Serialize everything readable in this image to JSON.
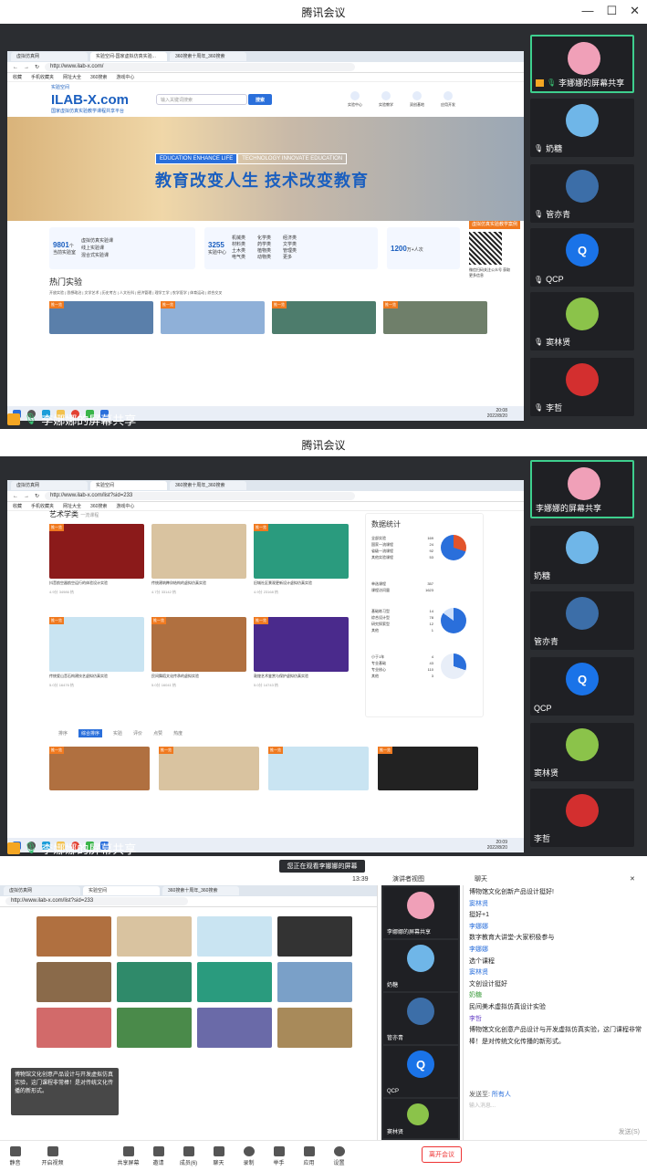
{
  "app_title": "腾讯会议",
  "window_controls": [
    "—",
    "☐",
    "✕"
  ],
  "share_label": "李娜娜的屏幕共享",
  "participants": [
    {
      "name": "李娜娜的屏幕共享",
      "color": "#f0a0b8"
    },
    {
      "name": "奶糖",
      "color": "#6fb6e8"
    },
    {
      "name": "管亦青",
      "color": "#3c6ea8"
    },
    {
      "name": "QCP",
      "color": "#1a73e8"
    },
    {
      "name": "窦林贤",
      "color": "#8bc34a"
    },
    {
      "name": "李哲",
      "color": "#d32f2f"
    }
  ],
  "browser": {
    "tabs": [
      "虚拟仿真网",
      "实验空间",
      "360搜索十周年_360搜索"
    ],
    "tabs_p1": [
      "虚拟仿真网",
      "实验空间-国家虚拟仿真实验...",
      "360搜索十周年_360搜索"
    ],
    "url1": "http://www.ilab-x.com/",
    "url2": "http://www.ilab-x.com/list?sid=233",
    "bookmarks": [
      "收藏",
      "手机收藏夹",
      "网址大全",
      "360搜索",
      "游戏中心"
    ]
  },
  "site": {
    "logo": "ILAB-X.com",
    "logo_top": "实验空间",
    "logo_sub": "国家虚拟仿真实验教学课程共享平台",
    "search_placeholder": "输入关键词搜索",
    "search_btn": "搜索",
    "nav": [
      "实验中心",
      "实验教学",
      "双创基地",
      "应用开发"
    ],
    "banner_tag1": "EDUCATION ENHANCE LIFE",
    "banner_tag2": "TECHNOLOGY INNOVATE EDUCATION",
    "banner_text": "教育改变人生  技术改变教育",
    "stat1_num": "9801",
    "stat1_unit": "个",
    "stat1_label": "当前实验室",
    "stat1_items": [
      "虚拟仿真实验课",
      "线上实验课",
      "混合式实验课"
    ],
    "stat2_num": "3255",
    "stat2_label": "实验中心",
    "stat2_items": [
      "机械类",
      "材料类",
      "土木类",
      "电气类",
      "化学类",
      "药学类",
      "植物类",
      "动物类",
      "经济类",
      "文学类",
      "管理类",
      "更多"
    ],
    "stat3_num": "1200",
    "stat3_label": "万+人次",
    "orange_btn": "虚拟仿真实验教学案例",
    "qr_caption": "微信扫码关注公众号 获取更多信息",
    "hot_title": "热门实验",
    "hot_line": "开放实验 | 思想政治 | 文学艺术 | 历史考古 | 人文社科 | 经济管理 | 理学工学 | 农学医学 | 体育运动 | 综合交叉",
    "card_tag": "推一览"
  },
  "taskbar": {
    "time": "20:08",
    "date": "2022/8/20",
    "time2": "20:09"
  },
  "list_page": {
    "section": "艺术学类",
    "section2": "一流课程",
    "cards": [
      {
        "title": "抖音航空器航空运行的体验设计实验",
        "score": "4.9分",
        "meta": "34986 热",
        "color": "#8b1a1a"
      },
      {
        "title": "传统建筑榫卯结构的虚拟仿真实验",
        "score": "4.7分",
        "meta": "33142 热",
        "color": "#d9c3a0"
      },
      {
        "title": "旧城社区景观更新设计虚拟仿真实验",
        "score": "4.9分",
        "meta": "23168 热",
        "color": "#2a9b7e"
      },
      {
        "title": "传统瓷山音石构建技艺虚拟仿真实验",
        "score": "5.0分",
        "meta": "16476 热",
        "color": "#c9e4f2"
      },
      {
        "title": "民间舞蹈文化传承的虚拟实验",
        "score": "5.0分",
        "meta": "16041 热",
        "color": "#b07040"
      },
      {
        "title": "敦煌艺术鉴赏与保护虚拟仿真实验",
        "score": "5.0分",
        "meta": "14743 热",
        "color": "#4a2a8c"
      }
    ],
    "stats_title": "数据统计",
    "stats_groups": [
      [
        [
          "全部实验",
          "169"
        ],
        [
          "国家一流课程",
          "24"
        ],
        [
          "省级一流课程",
          "92"
        ],
        [
          "其他实验课程",
          "53"
        ]
      ],
      [
        [
          "单选课程",
          "357"
        ],
        [
          "课程访问量",
          "1623"
        ]
      ],
      [
        [
          "基础练习型",
          "14"
        ],
        [
          "综合设计型",
          "78"
        ],
        [
          "研究探索型",
          "12"
        ],
        [
          "其他",
          "1"
        ]
      ],
      [
        [
          "小于1年",
          "4"
        ],
        [
          "专业基础",
          "43"
        ],
        [
          "专业核心",
          "110"
        ],
        [
          "其他",
          "3"
        ]
      ]
    ],
    "sort_label": "排序",
    "sort_active": "综合排序",
    "sort_items": [
      "实验",
      "评价",
      "点赞",
      "热度"
    ]
  },
  "panel3": {
    "banner": "您正在观看李娜娜的屏幕",
    "time": "13:39",
    "view_mode": "演讲者视图",
    "chat_title": "聊天",
    "messages": [
      {
        "user": "",
        "text": "博物馆文化创新产品设计挺好!"
      },
      {
        "user": "窦林贤",
        "text": "挺好+1"
      },
      {
        "user": "李娜娜",
        "text": "数字教育大讲堂-大家积极参与"
      },
      {
        "user": "李娜娜",
        "text": "选个课程"
      },
      {
        "user": "窦林贤",
        "text": "文创设计挺好"
      },
      {
        "user": "奶糖",
        "text": "民间美术虚拟仿真设计实验"
      },
      {
        "user": "李哲",
        "text": "博物馆文化创意产品设计与开发虚拟仿真实验，这门课程非常棒！是对传统文化传播的新形式。"
      }
    ],
    "send_to_label": "发送至:",
    "send_to": "所有人",
    "input_placeholder": "输入消息...",
    "send_btn": "发送(S)",
    "popup": "博物馆文化创意产品设计与开发虚拟仿真实验，这门课程非常棒！是对传统文化传播的新形式。",
    "controls": [
      "静音",
      "开启视频",
      "共享屏幕",
      "邀请",
      "成员(6)",
      "聊天",
      "录制",
      "举手",
      "应用",
      "设置"
    ],
    "end_btn": "离开会议"
  }
}
